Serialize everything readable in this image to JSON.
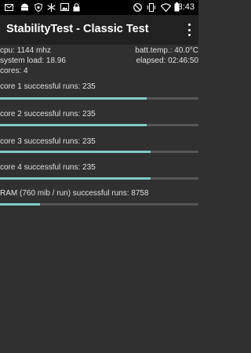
{
  "status_bar": {
    "time": "3:43",
    "left_icons": [
      "mail-icon",
      "android-icon",
      "shield-icon",
      "snowflake-icon",
      "image-icon",
      "lock-icon"
    ],
    "right_icons": [
      "do-not-disturb-icon",
      "vibrate-icon",
      "wifi-icon",
      "battery-icon"
    ]
  },
  "app_bar": {
    "title": "StabilityTest - Classic Test"
  },
  "info": {
    "cpu": "cpu: 1144 mhz",
    "batt_temp": "batt.temp.: 40.0°C",
    "system_load": "system load: 18.96",
    "elapsed": "elapsed: 02:46:50",
    "cores": "cores: 4"
  },
  "runs": [
    {
      "label": "core 1 successful runs: 235",
      "progress": 0.74
    },
    {
      "label": "core 2 successful runs: 235",
      "progress": 0.74
    },
    {
      "label": "core 3 successful runs: 235",
      "progress": 0.76
    },
    {
      "label": "core 4 successful runs: 235",
      "progress": 0.76
    },
    {
      "label": "RAM (760 mib / run) successful runs: 8758",
      "progress": 0.2
    }
  ],
  "colors": {
    "progress_fill": "#7fcbc4",
    "progress_track": "#555555",
    "background": "#303030",
    "app_bar": "#212121"
  }
}
